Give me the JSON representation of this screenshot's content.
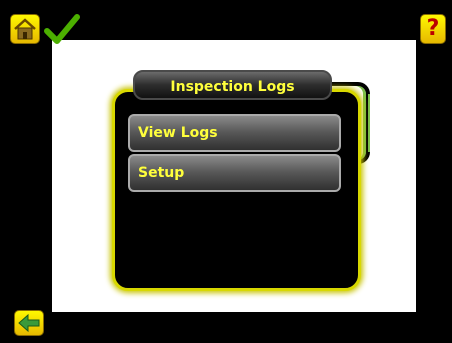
{
  "header": {
    "title": "Inspection Logs",
    "help_label": "?"
  },
  "menu": {
    "items": [
      {
        "label": "View Logs"
      },
      {
        "label": "Setup"
      }
    ]
  },
  "icons": {
    "home": "home-icon",
    "status": "checkmark-icon",
    "help": "help-icon",
    "back": "back-arrow-icon"
  },
  "colors": {
    "accent_yellow": "#ffff3c",
    "status_green": "#4caf00",
    "panel_glow": "#d8d800"
  }
}
